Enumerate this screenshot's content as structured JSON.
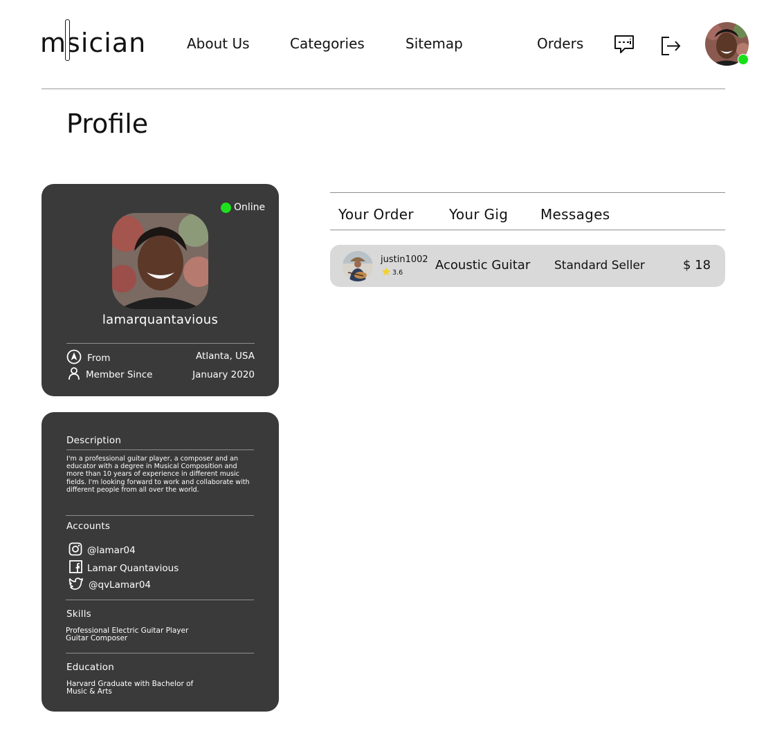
{
  "brand": {
    "logo_text": "msician"
  },
  "nav": {
    "about": "About Us",
    "categories": "Categories",
    "sitemap": "Sitemap",
    "orders": "Orders"
  },
  "header_icons": [
    "chat-icon",
    "logout-icon"
  ],
  "page_title": "Profile",
  "profile": {
    "status": "Online",
    "username": "lamarquantavious",
    "from_label": "From",
    "from_value": "Atlanta, USA",
    "member_label": "Member Since",
    "member_value": "January 2020"
  },
  "about": {
    "description_title": "Description",
    "description_text": "I'm a professional guitar player, a composer and an educator with a degree in Musical Composition and more than 10 years of experience in different music fields. I'm looking forward to work and collaborate with different people from all over the world.",
    "accounts_title": "Accounts",
    "accounts": [
      {
        "icon": "instagram-icon",
        "handle": "@lamar04"
      },
      {
        "icon": "facebook-icon",
        "handle": "Lamar Quantavious"
      },
      {
        "icon": "twitter-icon",
        "handle": "@qvLamar04"
      }
    ],
    "skills_title": "Skills",
    "skills": [
      "Professional Electric Guitar Player",
      "Guitar Composer"
    ],
    "education_title": "Education",
    "education_line1": "Harvard Graduate with Bachelor of",
    "education_line2": "Music & Arts"
  },
  "tabs": [
    "Your Order",
    "Your Gig",
    "Messages"
  ],
  "orders": [
    {
      "seller": "justin1002",
      "rating": "3.6",
      "gig": "Acoustic Guitar",
      "package": "Standard Seller",
      "price": "$ 18"
    }
  ],
  "colors": {
    "card_bg": "#3a3a3a",
    "online": "#1fe01f",
    "row_bg": "#d9d9d9",
    "star": "#f2d12e"
  }
}
